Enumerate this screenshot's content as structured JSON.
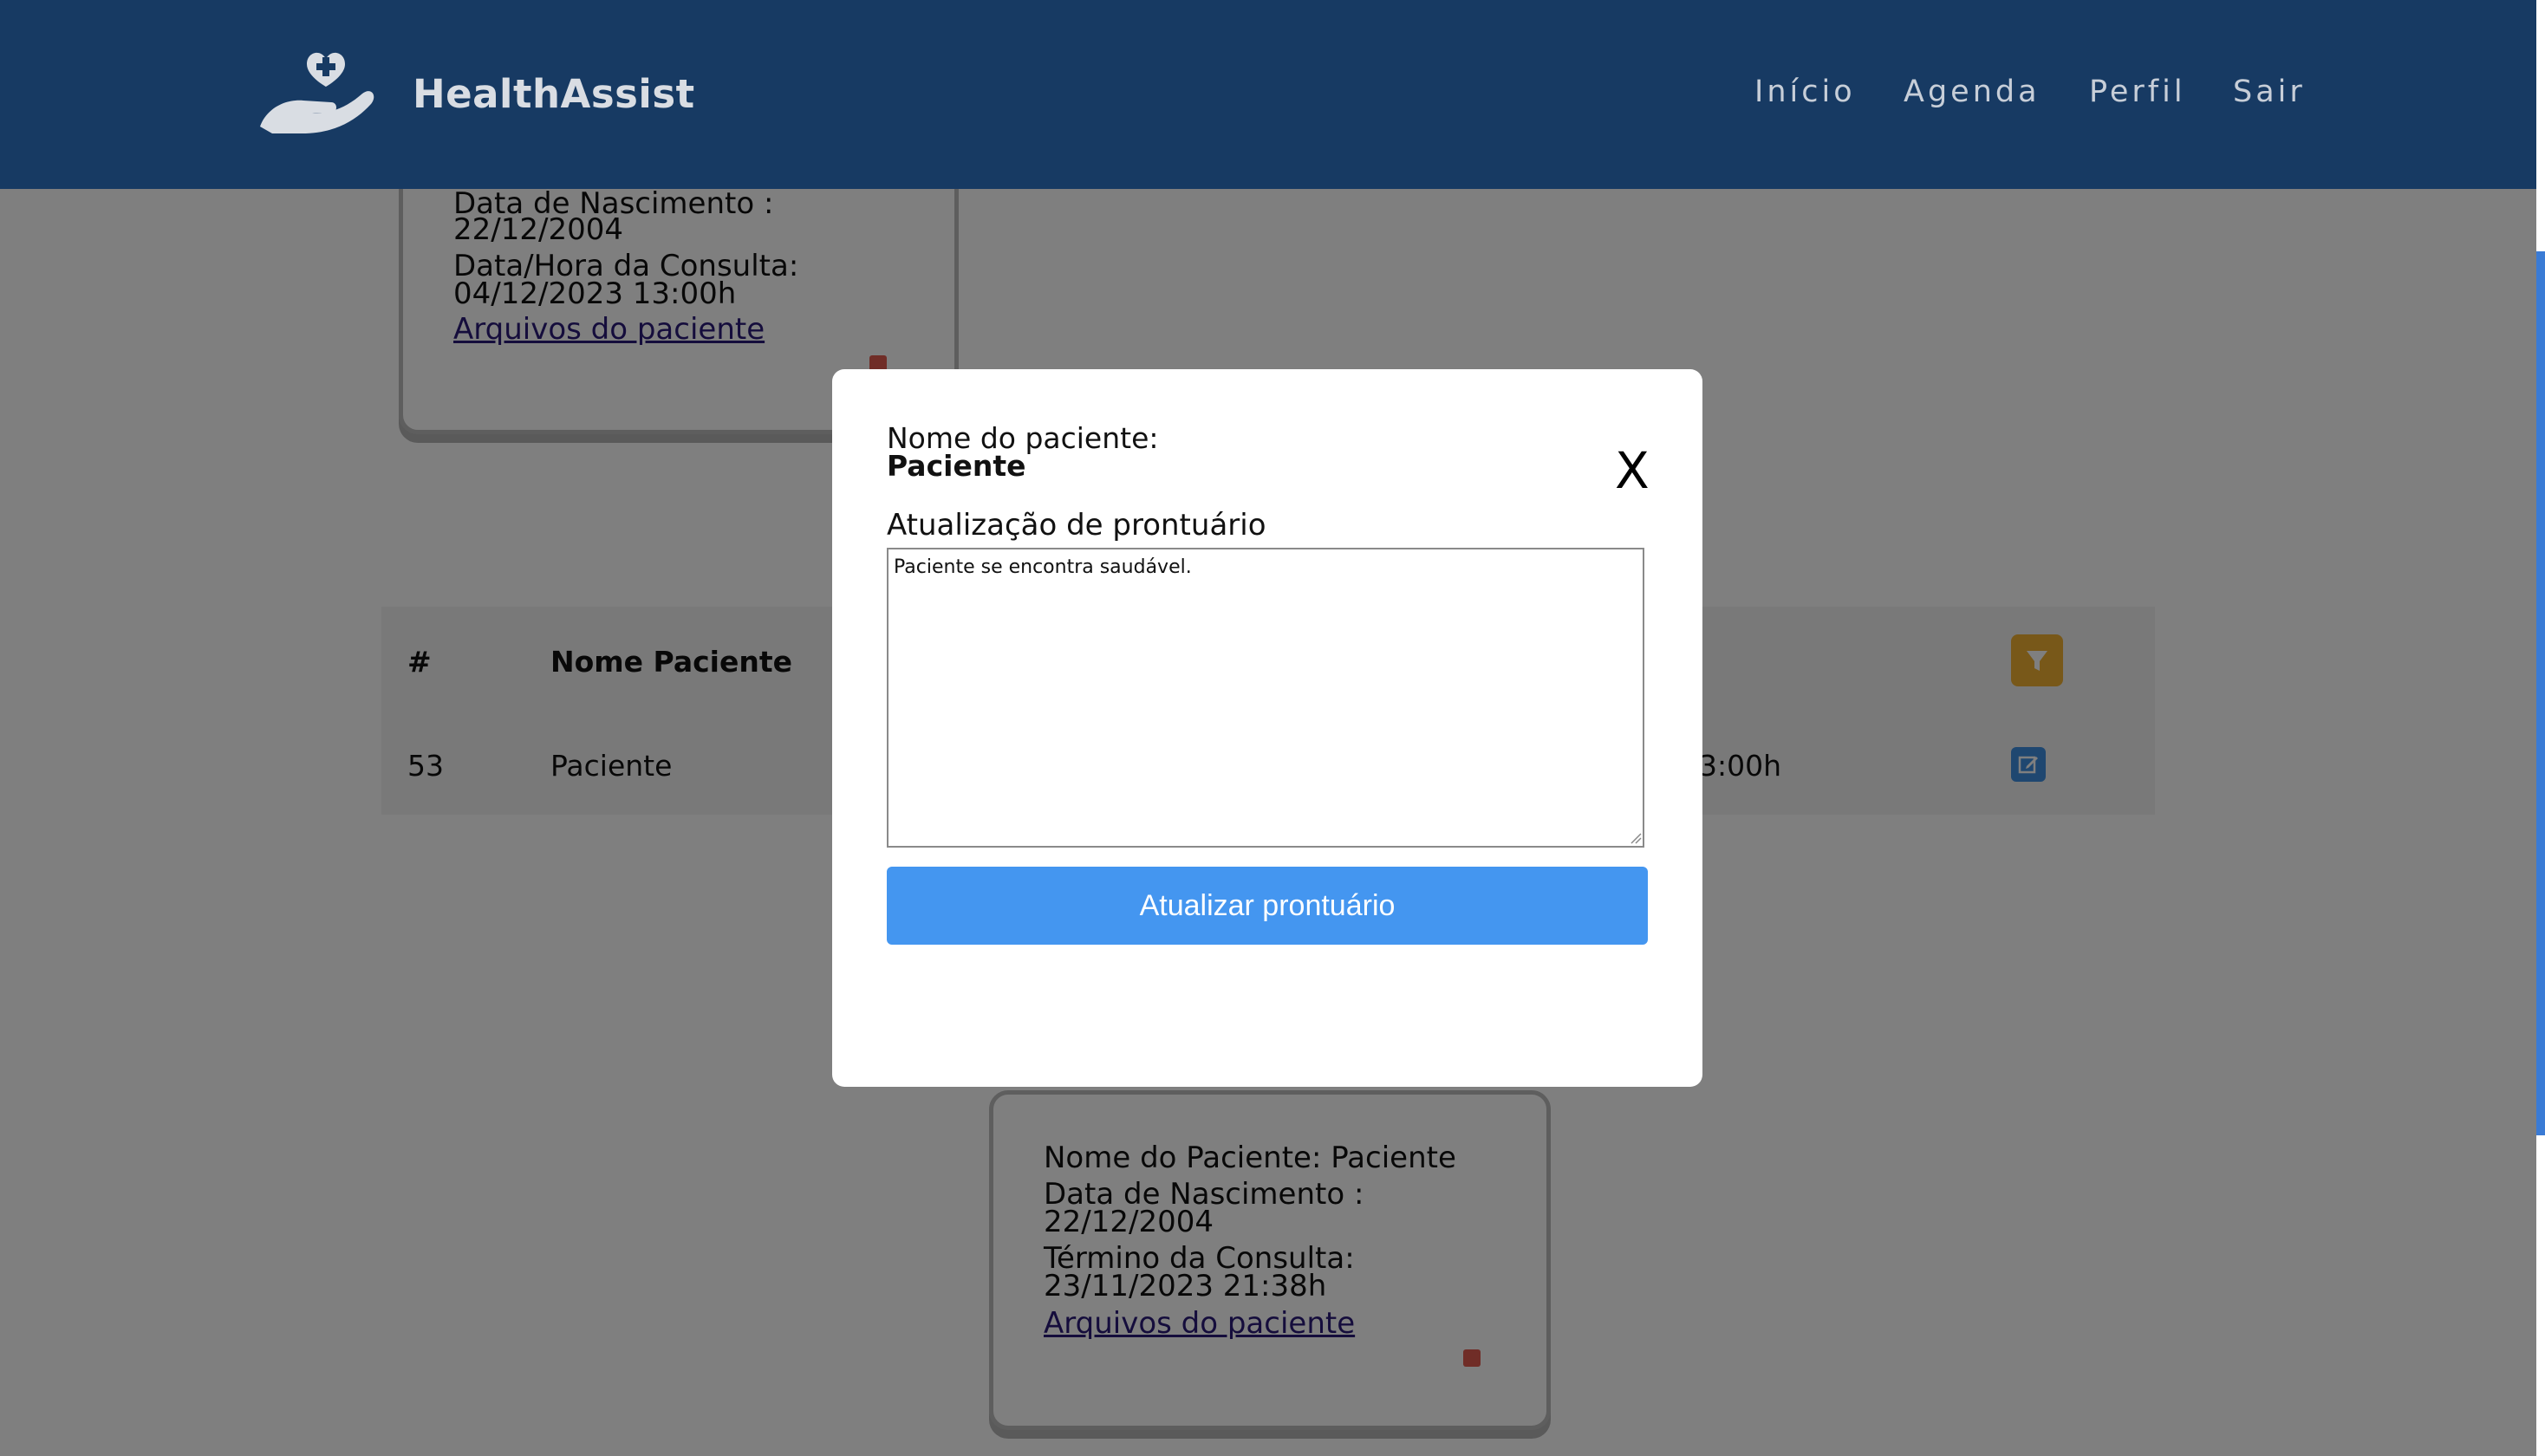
{
  "header": {
    "brand": "HealthAssist",
    "nav": [
      "Início",
      "Agenda",
      "Perfil",
      "Sair"
    ],
    "background_color": "#173a63"
  },
  "card_top": {
    "birth_label": "Data de Nascimento :",
    "birth_value": "22/12/2004",
    "consult_label": "Data/Hora da Consulta:",
    "consult_value": "04/12/2023 13:00h",
    "files_link": "Arquivos do paciente"
  },
  "table": {
    "headers": [
      "#",
      "Nome Paciente"
    ],
    "row": {
      "id": "53",
      "name": "Paciente",
      "time_partial": "3:00h"
    },
    "filter_icon": "filter-icon",
    "edit_icon": "edit-icon"
  },
  "card_bottom": {
    "name_line": "Nome do Paciente: Paciente",
    "birth_label": "Data de Nascimento :",
    "birth_value": "22/12/2004",
    "end_label": "Término da Consulta:",
    "end_value": "23/11/2023 21:38h",
    "files_link": "Arquivos do paciente"
  },
  "modal": {
    "patient_label": "Nome do paciente:",
    "patient_name": "Paciente",
    "close_label": "X",
    "section_title": "Atualização de prontuário",
    "textarea_value": "Paciente se encontra saudável.",
    "submit_label": "Atualizar prontuário",
    "submit_color": "#4496f0"
  }
}
